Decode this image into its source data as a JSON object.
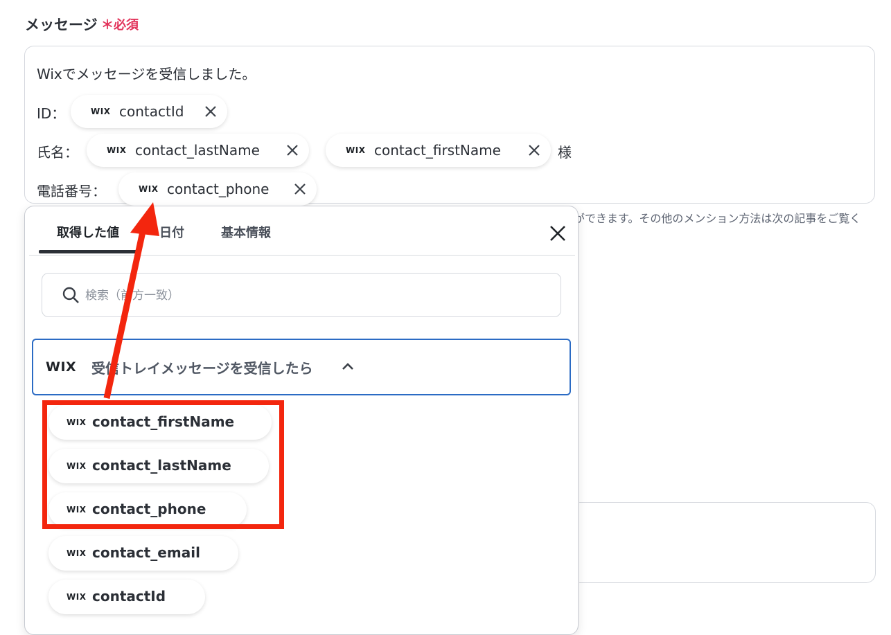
{
  "field": {
    "label": "メッセージ",
    "required_mark": "＊",
    "required_text": "必須"
  },
  "editor": {
    "line1": "Wixでメッセージを受信しました。",
    "line2_prefix": "ID：",
    "line3_prefix": "氏名：",
    "line3_suffix": "様",
    "line4_prefix": "電話番号：",
    "chips": [
      {
        "brand": "WIX",
        "label": "contactId"
      },
      {
        "brand": "WIX",
        "label": "contact_lastName"
      },
      {
        "brand": "WIX",
        "label": "contact_firstName"
      },
      {
        "brand": "WIX",
        "label": "contact_phone"
      }
    ]
  },
  "hint_text": "ができます。その他のメンション方法は次の記事をご覧く",
  "panel": {
    "tabs": [
      {
        "label": "取得した値",
        "active": true
      },
      {
        "label": "日付",
        "active": false
      },
      {
        "label": "基本情報",
        "active": false
      }
    ],
    "search_placeholder": "検索（前方一致）",
    "section": {
      "brand": "WIX",
      "title": "受信トレイメッセージを受信したら",
      "expanded": true
    },
    "items": [
      {
        "brand": "WIX",
        "label": "contact_firstName"
      },
      {
        "brand": "WIX",
        "label": "contact_lastName"
      },
      {
        "brand": "WIX",
        "label": "contact_phone"
      },
      {
        "brand": "WIX",
        "label": "contact_email"
      },
      {
        "brand": "WIX",
        "label": "contactId"
      }
    ]
  },
  "colors": {
    "required": "#e2335a",
    "highlight": "#f3260e",
    "section_border": "#2b6bc4"
  }
}
